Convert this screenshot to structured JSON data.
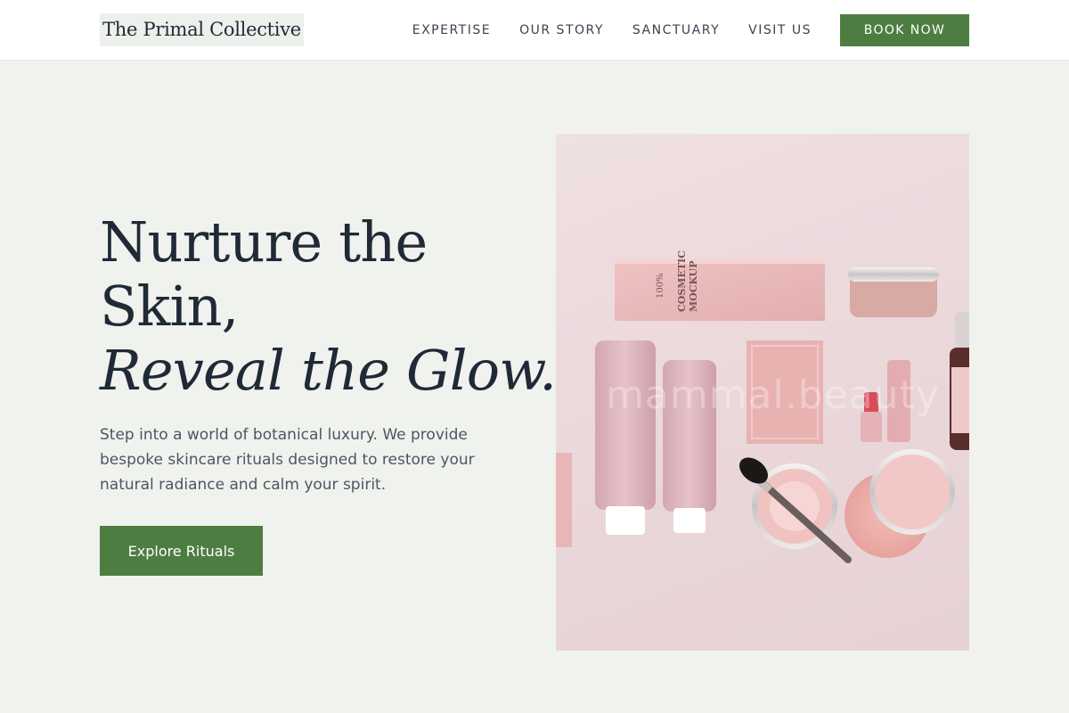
{
  "header": {
    "logo": "The Primal Collective",
    "nav": [
      {
        "label": "EXPERTISE"
      },
      {
        "label": "OUR STORY"
      },
      {
        "label": "SANCTUARY"
      },
      {
        "label": "VISIT US"
      }
    ],
    "cta_label": "BOOK NOW"
  },
  "hero": {
    "title_line1": "Nurture the",
    "title_line2": "Skin,",
    "title_line3": "Reveal the Glow.",
    "description": "Step into a world of botanical luxury. We provide bespoke skincare rituals designed to restore your natural radiance and calm your spirit.",
    "button_label": "Explore Rituals",
    "image": {
      "watermark": "mammal.beauty",
      "product_text": {
        "box_brand": "100%",
        "cosmetic": "COSMETIC",
        "mockup": "MOCKUP"
      }
    }
  },
  "colors": {
    "accent": "#4e7d42",
    "background": "#f0f2ee",
    "heading": "#1f2a36",
    "body_text": "#4d5560"
  }
}
